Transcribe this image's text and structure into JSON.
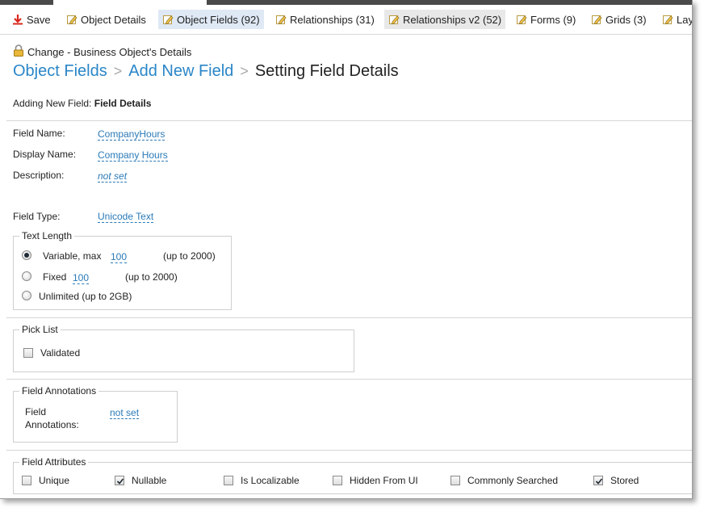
{
  "toolbar": {
    "save": "Save",
    "object_details": "Object Details",
    "object_fields": "Object Fields (92)",
    "relationships": "Relationships (31)",
    "relationships_v2": "Relationships v2 (52)",
    "forms": "Forms (9)",
    "grids": "Grids (3)",
    "layouts": "Lay"
  },
  "context": "Change - Business Object's Details",
  "breadcrumb": {
    "object_fields": "Object Fields",
    "add_new_field": "Add New Field",
    "current": "Setting Field Details",
    "sep": ">"
  },
  "subtitle": {
    "prefix": "Adding New Field:",
    "strong": "Field Details"
  },
  "fields": {
    "field_name_label": "Field Name:",
    "field_name_value": "CompanyHours",
    "display_name_label": "Display Name:",
    "display_name_value": "Company Hours",
    "description_label": "Description:",
    "description_value": "not set",
    "field_type_label": "Field Type:",
    "field_type_value": "Unicode Text"
  },
  "text_length": {
    "legend": "Text Length",
    "variable_label": "Variable, max",
    "variable_value": "100",
    "variable_hint": "(up to 2000)",
    "fixed_label": "Fixed",
    "fixed_value": "100",
    "fixed_hint": "(up to 2000)",
    "unlimited_label": "Unlimited (up to 2GB)",
    "selected": "variable"
  },
  "pick_list": {
    "legend": "Pick List",
    "validated_label": "Validated",
    "validated": false
  },
  "annotations": {
    "legend": "Field Annotations",
    "label_line1": "Field",
    "label_line2": "Annotations:",
    "value": "not set"
  },
  "attributes": {
    "legend": "Field Attributes",
    "unique": "Unique",
    "nullable": "Nullable",
    "is_localizable": "Is Localizable",
    "hidden_from_ui": "Hidden From UI",
    "commonly_searched": "Commonly Searched",
    "stored": "Stored",
    "checked": {
      "unique": false,
      "nullable": true,
      "is_localizable": false,
      "hidden_from_ui": false,
      "commonly_searched": false,
      "stored": true
    }
  },
  "colors": {
    "link": "#2a86c8",
    "active_tab": "#dfe9f5",
    "save_icon": "#d9261c"
  }
}
